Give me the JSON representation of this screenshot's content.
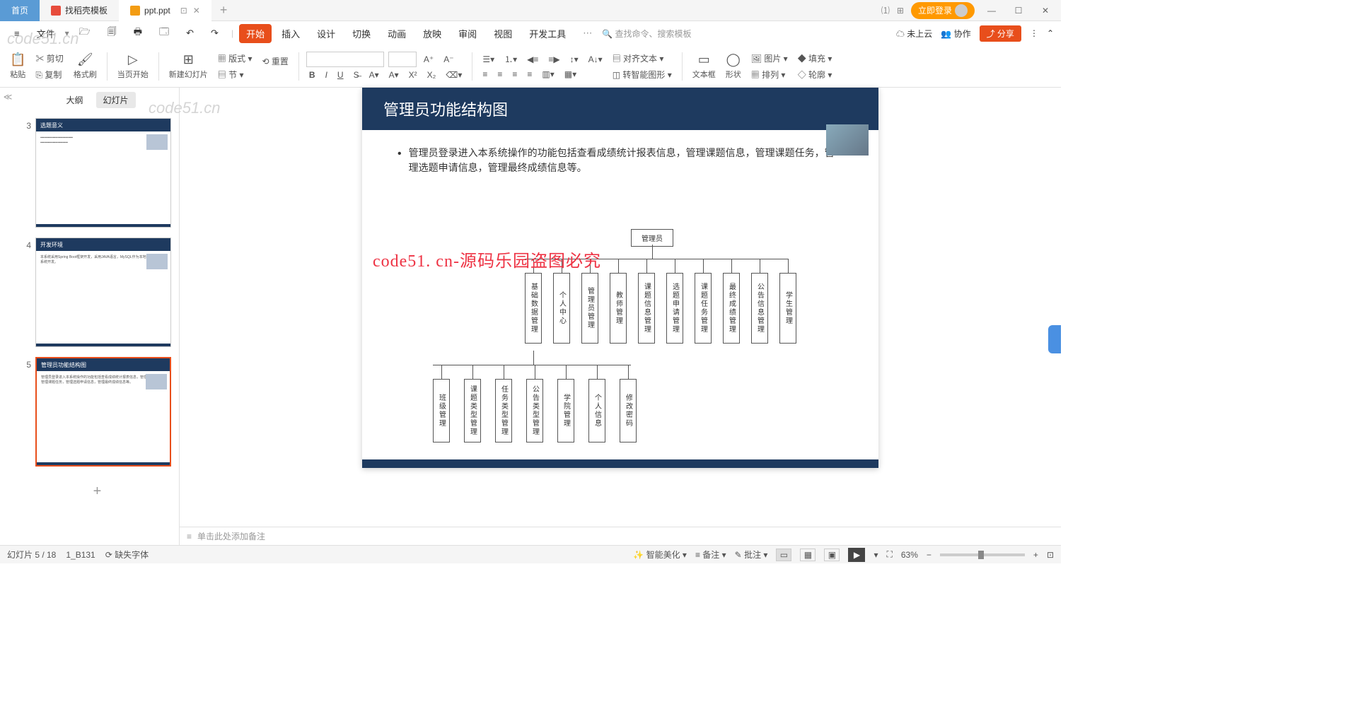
{
  "titlebar": {
    "home": "首页",
    "tab1": "找稻壳模板",
    "tab2": "ppt.ppt",
    "login": "立即登录"
  },
  "menubar": {
    "file": "文件",
    "items": [
      "开始",
      "插入",
      "设计",
      "切换",
      "动画",
      "放映",
      "审阅",
      "视图",
      "开发工具"
    ],
    "search_placeholder": "查找命令、搜索模板",
    "notcloud": "未上云",
    "collab": "协作",
    "share": "分享"
  },
  "toolbar": {
    "paste": "粘贴",
    "cut": "剪切",
    "copy": "复制",
    "format": "格式刷",
    "frompage": "当页开始",
    "newslide": "新建幻灯片",
    "layout": "版式",
    "section": "节",
    "reset": "重置",
    "aligntext": "对齐文本",
    "smartart": "转智能图形",
    "textbox": "文本框",
    "shape": "形状",
    "picture": "图片",
    "arrange": "排列",
    "fill": "填充",
    "outline": "轮廓"
  },
  "sidepanel": {
    "outline": "大纲",
    "slides": "幻灯片",
    "thumbs": [
      {
        "n": "3",
        "title": "选题意义"
      },
      {
        "n": "4",
        "title": "开发环境",
        "body": "本系统采用Spring Boot框架开发，采用JAVA语言，MySQL作为本地数据库进行系统开发。"
      },
      {
        "n": "5",
        "title": "管理员功能结构图",
        "body": "管理员登录进入本系统操作的功能包括查看成绩统计报表信息，管理课题信息，管理课题任务，管理选题申请信息，管理最终成绩信息等。"
      }
    ]
  },
  "slide": {
    "title": "管理员功能结构图",
    "bullet": "管理员登录进入本系统操作的功能包括查看成绩统计报表信息，管理课题信息，管理课题任务，管理选题申请信息，管理最终成绩信息等。",
    "watermark": "code51. cn-源码乐园盗图必究",
    "root": "管理员",
    "level2": [
      "基础数据管理",
      "个人中心",
      "管理员管理",
      "教师管理",
      "课题信息管理",
      "选题申请管理",
      "课题任务管理",
      "最终成绩管理",
      "公告信息管理",
      "学生管理"
    ],
    "level3": [
      "班级管理",
      "课题类型管理",
      "任务类型管理",
      "公告类型管理",
      "学院管理",
      "个人信息",
      "修改密码"
    ]
  },
  "notes": "单击此处添加备注",
  "statusbar": {
    "slide": "幻灯片 5 / 18",
    "layout": "1_B131",
    "missingfont": "缺失字体",
    "smartbeauty": "智能美化",
    "notes_btn": "备注",
    "comment": "批注",
    "zoom": "63%"
  },
  "watermarks": [
    "code51.cn"
  ]
}
